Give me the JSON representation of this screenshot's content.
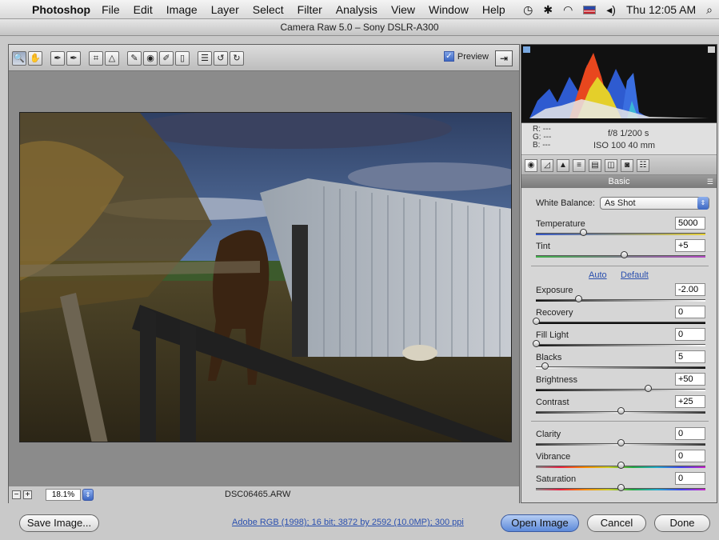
{
  "menubar": {
    "app_name": "Photoshop",
    "menus": [
      "File",
      "Edit",
      "Image",
      "Layer",
      "Select",
      "Filter",
      "Analysis",
      "View",
      "Window",
      "Help"
    ],
    "clock": "Thu 12:05 AM"
  },
  "window": {
    "title": "Camera Raw 5.0  –  Sony DSLR-A300"
  },
  "toolbar": {
    "tools": [
      {
        "icon": "zoom-icon",
        "glyph": "🔍"
      },
      {
        "icon": "hand-icon",
        "glyph": "✋"
      },
      {
        "icon": "white-balance-icon",
        "glyph": "✒"
      },
      {
        "icon": "color-sampler-icon",
        "glyph": "✒"
      },
      {
        "icon": "crop-icon",
        "glyph": "⌗"
      },
      {
        "icon": "straighten-icon",
        "glyph": "△"
      },
      {
        "icon": "spot-removal-icon",
        "glyph": "✎"
      },
      {
        "icon": "red-eye-icon",
        "glyph": "◉"
      },
      {
        "icon": "adjustment-brush-icon",
        "glyph": "✐"
      },
      {
        "icon": "graduated-filter-icon",
        "glyph": "▯"
      },
      {
        "icon": "preferences-icon",
        "glyph": "☰"
      },
      {
        "icon": "rotate-left-icon",
        "glyph": "↺"
      },
      {
        "icon": "rotate-right-icon",
        "glyph": "↻"
      }
    ],
    "preview_label": "Preview",
    "preview_checked": true
  },
  "status": {
    "zoom": "18.1%",
    "filename": "DSC06465.ARW"
  },
  "info": {
    "r": "R:  ---",
    "g": "G:  ---",
    "b": "B:  ---",
    "aperture_shutter": "f/8   1/200 s",
    "iso_focal": "ISO 100   40 mm"
  },
  "panel": {
    "title": "Basic",
    "white_balance_label": "White Balance:",
    "white_balance_value": "As Shot",
    "auto_label": "Auto",
    "default_label": "Default",
    "sliders": [
      {
        "label": "Temperature",
        "value": "5000",
        "pos": 0.28
      },
      {
        "label": "Tint",
        "value": "+5",
        "pos": 0.52
      },
      {
        "label": "Exposure",
        "value": "-2.00",
        "pos": 0.25
      },
      {
        "label": "Recovery",
        "value": "0",
        "pos": 0.0
      },
      {
        "label": "Fill Light",
        "value": "0",
        "pos": 0.0
      },
      {
        "label": "Blacks",
        "value": "5",
        "pos": 0.05
      },
      {
        "label": "Brightness",
        "value": "+50",
        "pos": 0.66
      },
      {
        "label": "Contrast",
        "value": "+25",
        "pos": 0.5
      },
      {
        "label": "Clarity",
        "value": "0",
        "pos": 0.5
      },
      {
        "label": "Vibrance",
        "value": "0",
        "pos": 0.5
      },
      {
        "label": "Saturation",
        "value": "0",
        "pos": 0.5
      }
    ]
  },
  "bottom": {
    "save_label": "Save Image...",
    "workflow_label": "Adobe RGB (1998); 16 bit; 3872 by 2592 (10.0MP); 300 ppi",
    "open_label": "Open Image",
    "cancel_label": "Cancel",
    "done_label": "Done"
  },
  "colors": {
    "accent": "#3c67c2",
    "link": "#2a4fae",
    "panel_bg": "#d6d6d6",
    "preview_bg": "#8b8b8b"
  }
}
